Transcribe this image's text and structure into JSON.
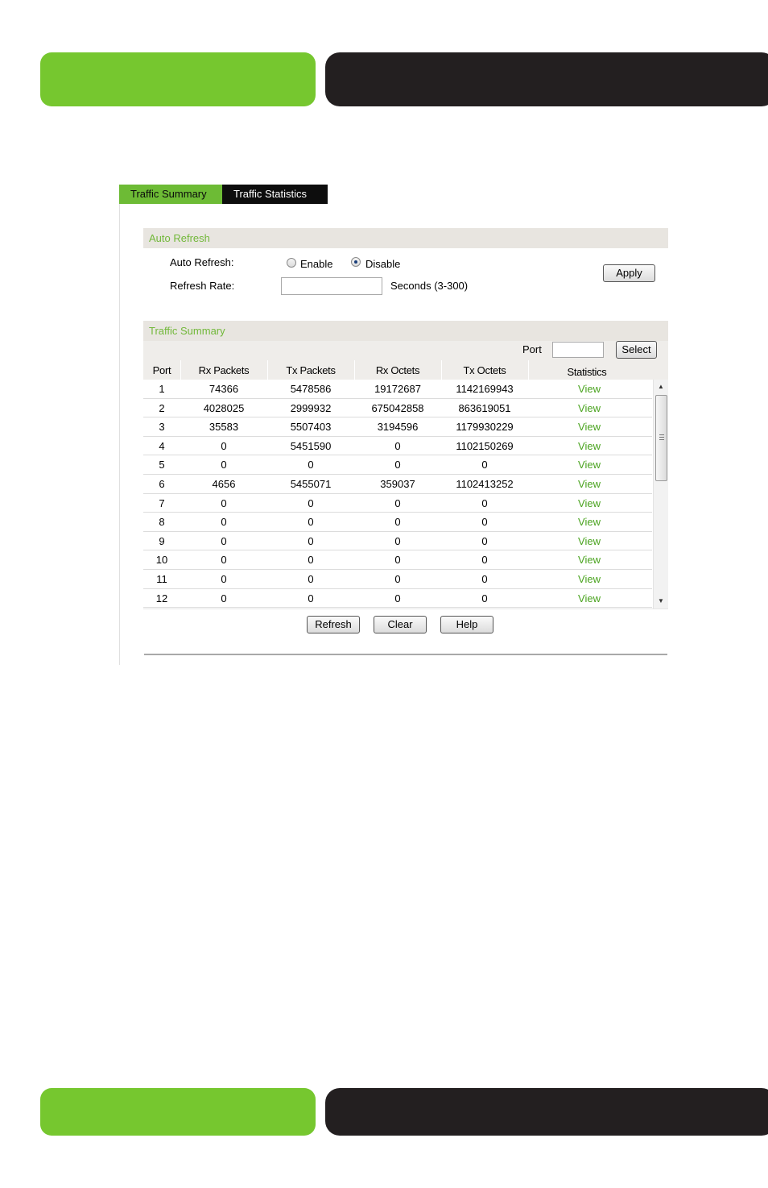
{
  "colors": {
    "accent_green": "#76c72f",
    "banner_dark": "#231f20",
    "link_green": "#4aa31f",
    "section_header_text": "#72b83a"
  },
  "tabs": [
    {
      "label": "Traffic Summary",
      "active": true
    },
    {
      "label": "Traffic Statistics",
      "active": false
    }
  ],
  "auto_refresh": {
    "header": "Auto Refresh",
    "auto_refresh_label": "Auto Refresh:",
    "enable_label": "Enable",
    "disable_label": "Disable",
    "selected": "Disable",
    "refresh_rate_label": "Refresh Rate:",
    "refresh_rate_value": "",
    "seconds_label": "Seconds (3-300)",
    "apply_label": "Apply"
  },
  "traffic_summary": {
    "header": "Traffic Summary",
    "port_label": "Port",
    "port_value": "",
    "select_label": "Select",
    "columns": [
      "Port",
      "Rx Packets",
      "Tx Packets",
      "Rx Octets",
      "Tx Octets",
      "Statistics"
    ],
    "rows": [
      [
        "1",
        "74366",
        "5478586",
        "19172687",
        "1142169943",
        "View"
      ],
      [
        "2",
        "4028025",
        "2999932",
        "675042858",
        "863619051",
        "View"
      ],
      [
        "3",
        "35583",
        "5507403",
        "3194596",
        "1179930229",
        "View"
      ],
      [
        "4",
        "0",
        "5451590",
        "0",
        "1102150269",
        "View"
      ],
      [
        "5",
        "0",
        "0",
        "0",
        "0",
        "View"
      ],
      [
        "6",
        "4656",
        "5455071",
        "359037",
        "1102413252",
        "View"
      ],
      [
        "7",
        "0",
        "0",
        "0",
        "0",
        "View"
      ],
      [
        "8",
        "0",
        "0",
        "0",
        "0",
        "View"
      ],
      [
        "9",
        "0",
        "0",
        "0",
        "0",
        "View"
      ],
      [
        "10",
        "0",
        "0",
        "0",
        "0",
        "View"
      ],
      [
        "11",
        "0",
        "0",
        "0",
        "0",
        "View"
      ],
      [
        "12",
        "0",
        "0",
        "0",
        "0",
        "View"
      ]
    ],
    "refresh_label": "Refresh",
    "clear_label": "Clear",
    "help_label": "Help"
  },
  "icons": {
    "scroll_up": "scroll-up-arrow-icon",
    "scroll_down": "scroll-down-arrow-icon"
  }
}
